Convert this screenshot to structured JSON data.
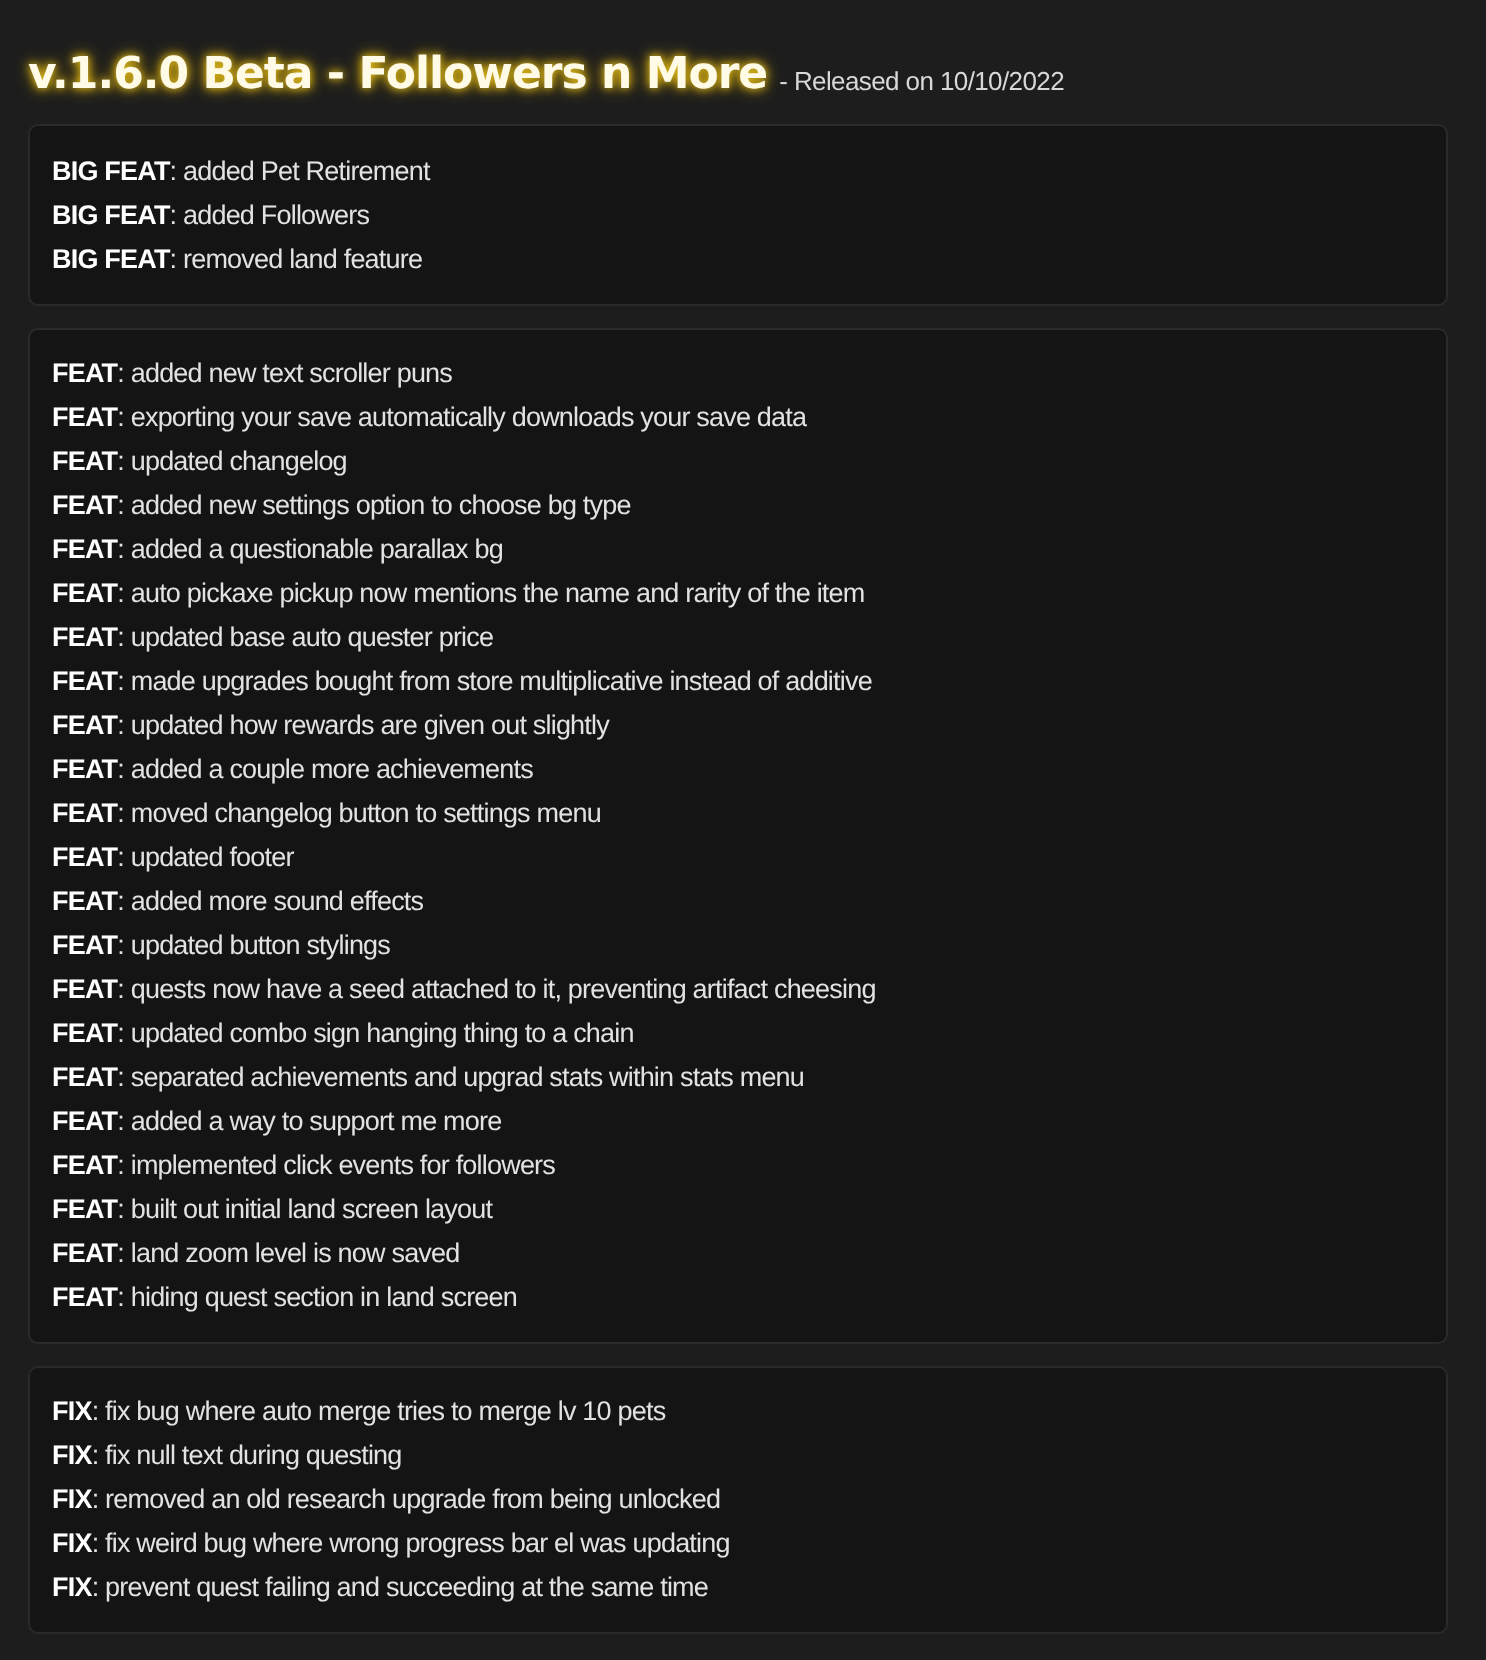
{
  "header": {
    "title": "v.1.6.0 Beta - Followers n More",
    "released": "- Released on 10/10/2022"
  },
  "sections": [
    {
      "items": [
        {
          "tag": "BIG FEAT",
          "text": ": added Pet Retirement"
        },
        {
          "tag": "BIG FEAT",
          "text": ": added Followers"
        },
        {
          "tag": "BIG FEAT",
          "text": ": removed land feature"
        }
      ]
    },
    {
      "items": [
        {
          "tag": "FEAT",
          "text": ": added new text scroller puns"
        },
        {
          "tag": "FEAT",
          "text": ": exporting your save automatically downloads your save data"
        },
        {
          "tag": "FEAT",
          "text": ": updated changelog"
        },
        {
          "tag": "FEAT",
          "text": ": added new settings option to choose bg type"
        },
        {
          "tag": "FEAT",
          "text": ": added a questionable parallax bg"
        },
        {
          "tag": "FEAT",
          "text": ": auto pickaxe pickup now mentions the name and rarity of the item"
        },
        {
          "tag": "FEAT",
          "text": ": updated base auto quester price"
        },
        {
          "tag": "FEAT",
          "text": ": made upgrades bought from store multiplicative instead of additive"
        },
        {
          "tag": "FEAT",
          "text": ": updated how rewards are given out slightly"
        },
        {
          "tag": "FEAT",
          "text": ": added a couple more achievements"
        },
        {
          "tag": "FEAT",
          "text": ": moved changelog button to settings menu"
        },
        {
          "tag": "FEAT",
          "text": ": updated footer"
        },
        {
          "tag": "FEAT",
          "text": ": added more sound effects"
        },
        {
          "tag": "FEAT",
          "text": ": updated button stylings"
        },
        {
          "tag": "FEAT",
          "text": ": quests now have a seed attached to it, preventing artifact cheesing"
        },
        {
          "tag": "FEAT",
          "text": ": updated combo sign hanging thing to a chain"
        },
        {
          "tag": "FEAT",
          "text": ": separated achievements and upgrad stats within stats menu"
        },
        {
          "tag": "FEAT",
          "text": ": added a way to support me more"
        },
        {
          "tag": "FEAT",
          "text": ": implemented click events for followers"
        },
        {
          "tag": "FEAT",
          "text": ": built out initial land screen layout"
        },
        {
          "tag": "FEAT",
          "text": ": land zoom level is now saved"
        },
        {
          "tag": "FEAT",
          "text": ": hiding quest section in land screen"
        }
      ]
    },
    {
      "items": [
        {
          "tag": "FIX",
          "text": ": fix bug where auto merge tries to merge lv 10 pets"
        },
        {
          "tag": "FIX",
          "text": ": fix null text during questing"
        },
        {
          "tag": "FIX",
          "text": ": removed an old research upgrade from being unlocked"
        },
        {
          "tag": "FIX",
          "text": ": fix weird bug where wrong progress bar el was updating"
        },
        {
          "tag": "FIX",
          "text": ": prevent quest failing and succeeding at the same time"
        }
      ]
    }
  ]
}
